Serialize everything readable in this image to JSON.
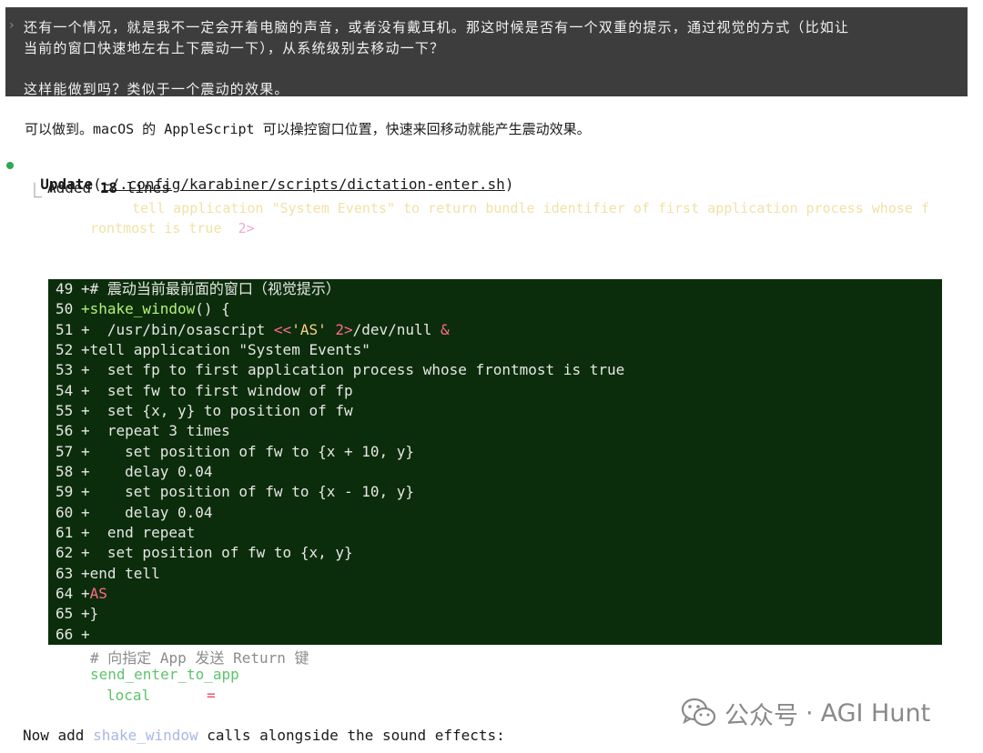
{
  "prompt": {
    "lines": [
      "还有一个情况，就是我不一定会开着电脑的声音，或者没有戴耳机。那这时候是否有一个双重的提示，通过视觉的方式（比如让",
      "当前的窗口快速地左右上下震动一下），从系统级别去移动一下？",
      "这样能做到吗？类似于一个震动的效果。"
    ]
  },
  "reply": "可以做到。macOS 的 AppleScript 可以操控窗口位置，快速来回移动就能产生震动效果。",
  "tool_call": {
    "name": "Update",
    "path": "~/.config/karabiner/scripts/dictation-enter.sh",
    "summary_prefix": "Added ",
    "summary_count": "18",
    "summary_suffix": " lines"
  },
  "faded_context": {
    "line1": "tell application \"System Events\" to return bundle identifier of first application process whose f",
    "line2": "rontmost is true",
    "redir": "2>"
  },
  "diff": [
    {
      "num": "49",
      "text": "+# 震动当前最前面的窗口（视觉提示）"
    },
    {
      "num": "50",
      "fn": "+shake_window",
      "text": "() {"
    },
    {
      "num": "51",
      "pre": "+  /usr/bin/osascript ",
      "red1": "<<",
      "str": "'AS'",
      "mid": " ",
      "red2": "2>",
      "post": "/dev/null ",
      "red3": "&"
    },
    {
      "num": "52",
      "text": "+tell application \"System Events\""
    },
    {
      "num": "53",
      "text": "+  set fp to first application process whose frontmost is true"
    },
    {
      "num": "54",
      "text": "+  set fw to first window of fp"
    },
    {
      "num": "55",
      "text": "+  set {x, y} to position of fw"
    },
    {
      "num": "56",
      "text": "+  repeat 3 times"
    },
    {
      "num": "57",
      "text": "+    set position of fw to {x + 10, y}"
    },
    {
      "num": "58",
      "text": "+    delay 0.04"
    },
    {
      "num": "59",
      "text": "+    set position of fw to {x - 10, y}"
    },
    {
      "num": "60",
      "text": "+    delay 0.04"
    },
    {
      "num": "61",
      "text": "+  end repeat"
    },
    {
      "num": "62",
      "text": "+  set position of fw to {x, y}"
    },
    {
      "num": "63",
      "text": "+end tell"
    },
    {
      "num": "64",
      "pre": "+",
      "red1": "AS"
    },
    {
      "num": "65",
      "text": "+}"
    },
    {
      "num": "66",
      "text": "+"
    }
  ],
  "after_diff": {
    "comment": "# 向指定 App 发送 Return 键",
    "call": "send_enter_to_app",
    "local_kw": "local",
    "eq": "="
  },
  "footer": {
    "prefix": "Now add ",
    "highlight": "shake_window",
    "suffix": " calls alongside the sound effects:"
  },
  "watermark": {
    "channel": "公众号",
    "sep": "·",
    "name": "AGI Hunt",
    "icon": "wechat-icon"
  }
}
